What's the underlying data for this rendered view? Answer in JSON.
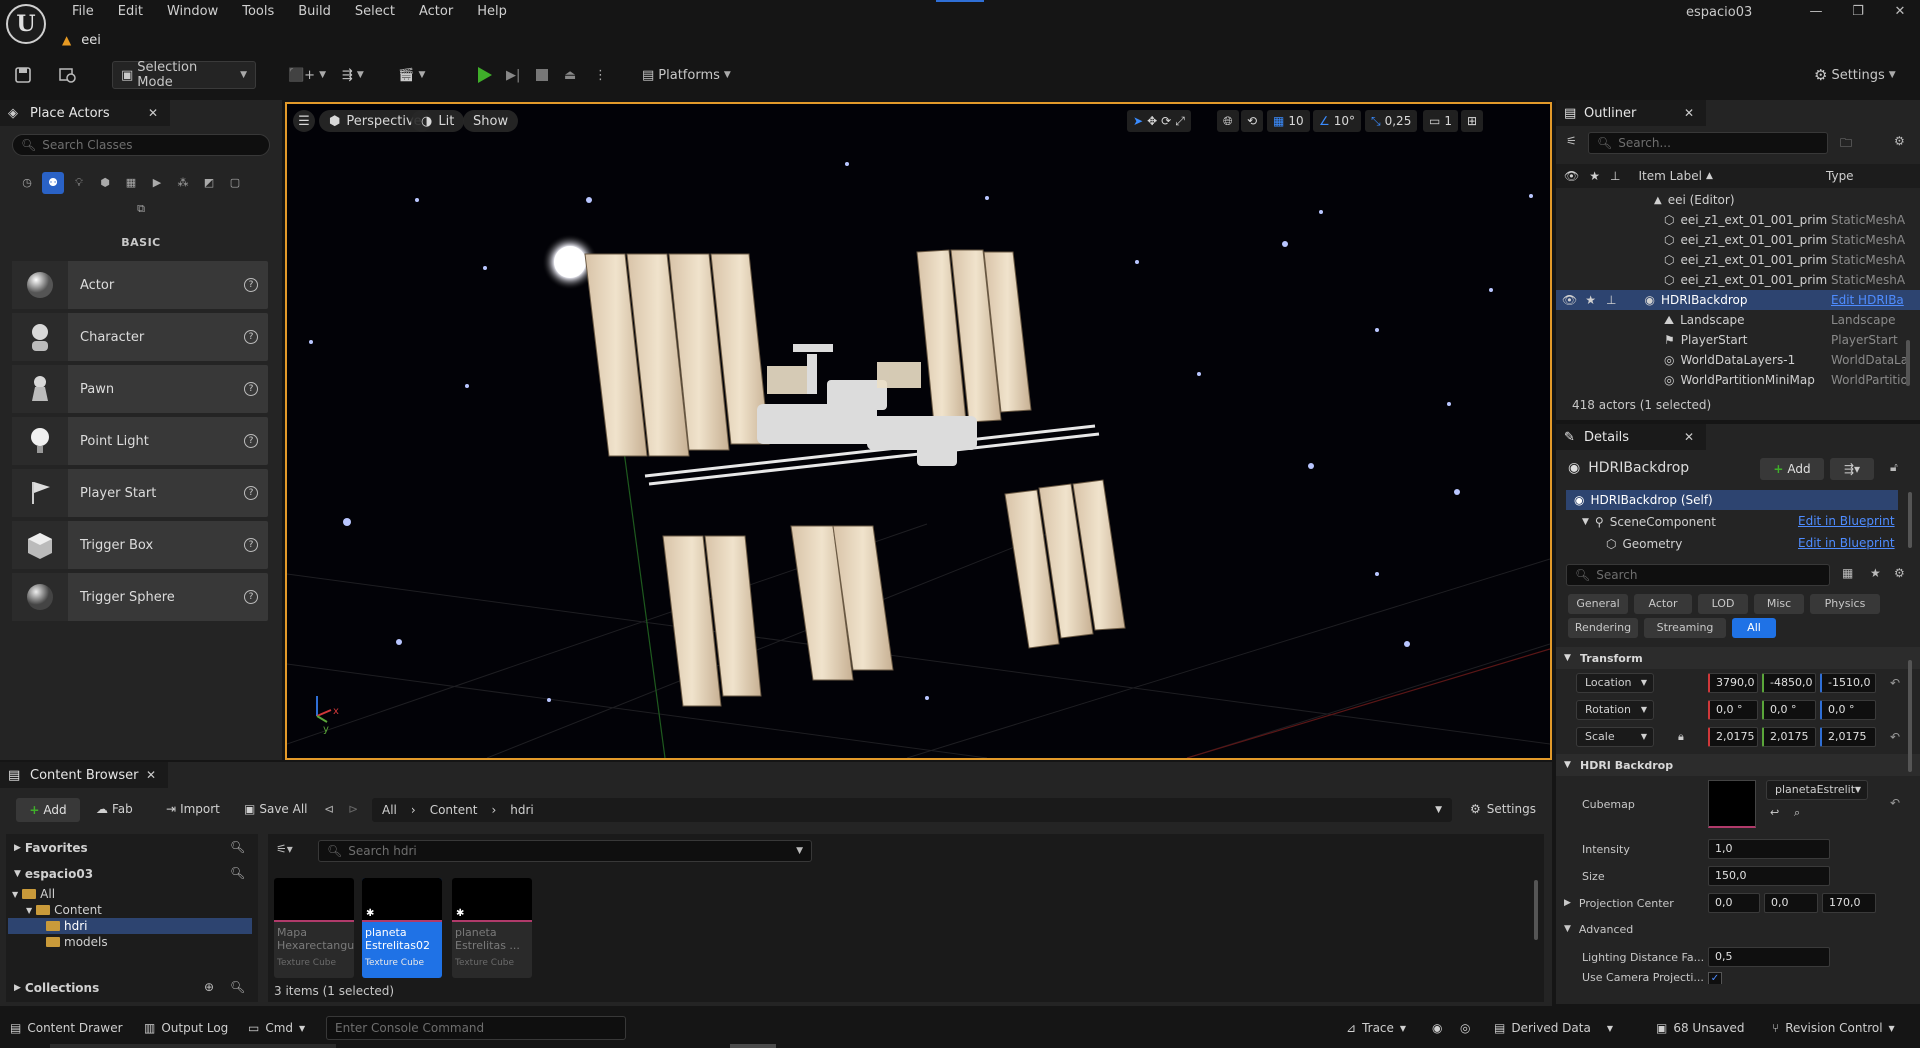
{
  "app": {
    "project_name": "espacio03",
    "menu": [
      "File",
      "Edit",
      "Window",
      "Tools",
      "Build",
      "Select",
      "Actor",
      "Help"
    ],
    "doc_tab": "eei",
    "logo": "U"
  },
  "toolbar": {
    "selection_mode": "Selection Mode",
    "platforms": "Platforms",
    "settings": "Settings"
  },
  "place_actors": {
    "tab_title": "Place Actors",
    "search_placeholder": "Search Classes",
    "category": "BASIC",
    "items": [
      {
        "label": "Actor",
        "icon": "sphere-icon"
      },
      {
        "label": "Character",
        "icon": "character-icon"
      },
      {
        "label": "Pawn",
        "icon": "pawn-icon"
      },
      {
        "label": "Point Light",
        "icon": "lightbulb-icon"
      },
      {
        "label": "Player Start",
        "icon": "flag-icon"
      },
      {
        "label": "Trigger Box",
        "icon": "box-icon"
      },
      {
        "label": "Trigger Sphere",
        "icon": "sphere-icon"
      }
    ]
  },
  "viewport": {
    "view_mode": "Perspective",
    "lighting": "Lit",
    "show": "Show",
    "grid_snap": "10",
    "rotation_snap": "10°",
    "scale_snap": "0,25",
    "camera_speed": "1"
  },
  "outliner": {
    "tab_title": "Outliner",
    "search_placeholder": "Search...",
    "col_label": "Item Label",
    "col_type": "Type",
    "rows": [
      {
        "label": "eei (Editor)",
        "type": ""
      },
      {
        "label": "eei_z1_ext_01_001_prim",
        "type": "StaticMeshA"
      },
      {
        "label": "eei_z1_ext_01_001_prim",
        "type": "StaticMeshA"
      },
      {
        "label": "eei_z1_ext_01_001_prim",
        "type": "StaticMeshA"
      },
      {
        "label": "eei_z1_ext_01_001_prim",
        "type": "StaticMeshA"
      },
      {
        "label": "HDRIBackdrop",
        "type": "Edit HDRIBa"
      },
      {
        "label": "Landscape",
        "type": "Landscape"
      },
      {
        "label": "PlayerStart",
        "type": "PlayerStart"
      },
      {
        "label": "WorldDataLayers-1",
        "type": "WorldDataLa"
      },
      {
        "label": "WorldPartitionMiniMap",
        "type": "WorldPartitio"
      }
    ],
    "footer": "418 actors (1 selected)"
  },
  "details": {
    "tab_title": "Details",
    "object_name": "HDRIBackdrop",
    "add_label": "Add",
    "components": [
      {
        "label": "HDRIBackdrop (Self)",
        "action": ""
      },
      {
        "label": "SceneComponent",
        "action": "Edit in Blueprint"
      },
      {
        "label": "Geometry",
        "action": "Edit in Blueprint"
      }
    ],
    "search_placeholder": "Search",
    "filters_row1": [
      "General",
      "Actor",
      "LOD",
      "Misc",
      "Physics"
    ],
    "filters_row2": [
      "Rendering",
      "Streaming",
      "All"
    ],
    "transform": {
      "header": "Transform",
      "location_label": "Location",
      "location": [
        "3790,0",
        "-4850,0",
        "-1510,0"
      ],
      "rotation_label": "Rotation",
      "rotation": [
        "0,0 °",
        "0,0 °",
        "0,0 °"
      ],
      "scale_label": "Scale",
      "scale": [
        "2,0175",
        "2,0175",
        "2,0175"
      ]
    },
    "hdri": {
      "header": "HDRI Backdrop",
      "cubemap_label": "Cubemap",
      "cubemap_value": "planetaEstrelit",
      "intensity_label": "Intensity",
      "intensity": "1,0",
      "size_label": "Size",
      "size": "150,0",
      "projection_label": "Projection Center",
      "projection": [
        "0,0",
        "0,0",
        "170,0"
      ]
    },
    "advanced": {
      "header": "Advanced",
      "lighting_distance_label": "Lighting Distance Fa...",
      "lighting_distance": "0,5",
      "use_camera_label": "Use Camera Projecti..."
    }
  },
  "content_browser": {
    "tab_title": "Content Browser",
    "add": "Add",
    "fab": "Fab",
    "import": "Import",
    "save_all": "Save All",
    "path": [
      "All",
      "Content",
      "hdri"
    ],
    "settings": "Settings",
    "favorites": "Favorites",
    "project": "espacio03",
    "tree": [
      "All",
      "Content",
      "hdri",
      "models"
    ],
    "collections": "Collections",
    "search_placeholder": "Search hdri",
    "assets": [
      {
        "name": "Mapa Hexarectangu...",
        "type": "Texture Cube"
      },
      {
        "name": "planeta Estrelitas02",
        "type": "Texture Cube"
      },
      {
        "name": "planeta Estrelitas ...",
        "type": "Texture Cube"
      }
    ],
    "footer": "3 items (1 selected)"
  },
  "statusbar": {
    "content_drawer": "Content Drawer",
    "output_log": "Output Log",
    "cmd": "Cmd",
    "console_placeholder": "Enter Console Command",
    "trace": "Trace",
    "derived_data": "Derived Data",
    "unsaved": "68 Unsaved",
    "revision_control": "Revision Control"
  },
  "colors": {
    "accent_blue": "#1f72e6",
    "viewport_border": "#e39a2a",
    "panel_bg": "#242424"
  }
}
